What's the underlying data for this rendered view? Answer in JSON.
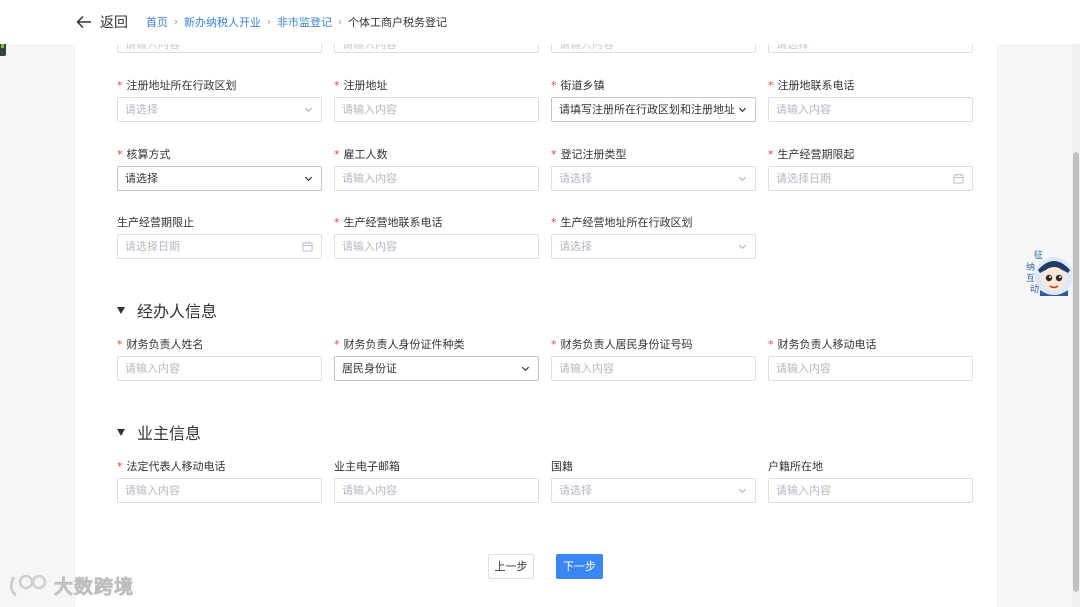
{
  "topbar": {
    "back_label": "返回",
    "breadcrumb": [
      "首页",
      "新办纳税人开业",
      "非市监登记",
      "个体工商户税务登记"
    ]
  },
  "top_partial": [
    "请输入内容",
    "请输入内容",
    "请输入内容",
    "请选择"
  ],
  "rows": [
    [
      {
        "label": "注册地址所在行政区划",
        "required": true,
        "value": "请选择",
        "kind": "select",
        "filled": false
      },
      {
        "label": "注册地址",
        "required": true,
        "value": "请输入内容",
        "kind": "input",
        "filled": false
      },
      {
        "label": "街道乡镇",
        "required": true,
        "value": "请填写注册所在行政区划和注册地址",
        "kind": "select",
        "filled": true
      },
      {
        "label": "注册地联系电话",
        "required": true,
        "value": "请输入内容",
        "kind": "input",
        "filled": false
      }
    ],
    [
      {
        "label": "核算方式",
        "required": true,
        "value": "请选择",
        "kind": "select",
        "filled": true
      },
      {
        "label": "雇工人数",
        "required": true,
        "value": "请输入内容",
        "kind": "input",
        "filled": false
      },
      {
        "label": "登记注册类型",
        "required": true,
        "value": "请选择",
        "kind": "select",
        "filled": false
      },
      {
        "label": "生产经营期限起",
        "required": true,
        "value": "请选择日期",
        "kind": "date",
        "filled": false
      }
    ],
    [
      {
        "label": "生产经营期限止",
        "required": false,
        "value": "请选择日期",
        "kind": "date",
        "filled": false
      },
      {
        "label": "生产经营地联系电话",
        "required": true,
        "value": "请输入内容",
        "kind": "input",
        "filled": false
      },
      {
        "label": "生产经营地址所在行政区划",
        "required": true,
        "value": "请选择",
        "kind": "select",
        "filled": false
      }
    ]
  ],
  "section_agent": {
    "title": "经办人信息",
    "fields": [
      {
        "label": "财务负责人姓名",
        "required": true,
        "value": "请输入内容",
        "kind": "input",
        "filled": false
      },
      {
        "label": "财务负责人身份证件种类",
        "required": true,
        "value": "居民身份证",
        "kind": "select",
        "filled": true
      },
      {
        "label": "财务负责人居民身份证号码",
        "required": true,
        "value": "请输入内容",
        "kind": "input",
        "filled": false
      },
      {
        "label": "财务负责人移动电话",
        "required": true,
        "value": "请输入内容",
        "kind": "input",
        "filled": false
      }
    ]
  },
  "section_owner": {
    "title": "业主信息",
    "fields": [
      {
        "label": "法定代表人移动电话",
        "required": true,
        "value": "请输入内容",
        "kind": "input",
        "filled": false
      },
      {
        "label": "业主电子邮箱",
        "required": false,
        "value": "请输入内容",
        "kind": "input",
        "filled": false
      },
      {
        "label": "国籍",
        "required": false,
        "value": "请选择",
        "kind": "select",
        "filled": false
      },
      {
        "label": "户籍所在地",
        "required": false,
        "value": "请输入内容",
        "kind": "input",
        "filled": false
      }
    ]
  },
  "buttons": {
    "prev": "上一步",
    "next": "下一步"
  },
  "watermark": "大数跨境",
  "assistant": {
    "label": "征纳互动",
    "chars": [
      "征",
      "纳",
      "互",
      "动"
    ]
  },
  "colors": {
    "accent": "#3a86f5",
    "link": "#3b82d9",
    "required": "#e8453c"
  }
}
